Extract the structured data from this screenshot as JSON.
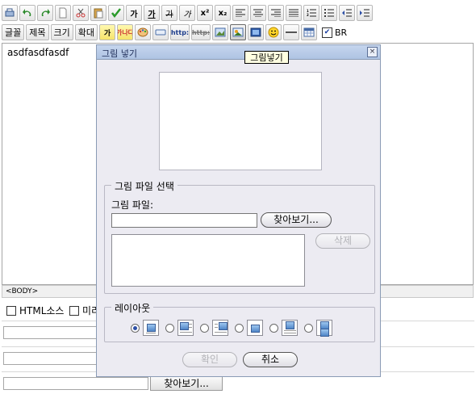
{
  "toolbar_row1": [
    {
      "name": "print-icon",
      "label": ""
    },
    {
      "name": "undo-icon",
      "label": ""
    },
    {
      "name": "redo-icon",
      "label": ""
    },
    {
      "name": "new-page-icon",
      "label": ""
    },
    {
      "name": "cut-icon",
      "label": ""
    },
    {
      "name": "paste-icon",
      "label": ""
    },
    {
      "name": "spellcheck-icon",
      "label": ""
    },
    {
      "name": "bold-button",
      "label": "가"
    },
    {
      "name": "underline-button",
      "label": "가"
    },
    {
      "name": "strikethrough-button",
      "label": "가"
    },
    {
      "name": "italic-button",
      "label": "가"
    },
    {
      "name": "superscript-button",
      "label": "x²"
    },
    {
      "name": "subscript-button",
      "label": "x₂"
    },
    {
      "name": "align-left-icon",
      "label": ""
    },
    {
      "name": "align-center-icon",
      "label": ""
    },
    {
      "name": "align-right-icon",
      "label": ""
    },
    {
      "name": "align-justify-icon",
      "label": ""
    },
    {
      "name": "numbered-list-icon",
      "label": ""
    },
    {
      "name": "bullet-list-icon",
      "label": ""
    },
    {
      "name": "outdent-icon",
      "label": ""
    },
    {
      "name": "indent-icon",
      "label": ""
    }
  ],
  "toolbar_row2": {
    "font_label": "글꼴",
    "style_label": "제목",
    "size_label": "크기",
    "zoom_label": "확대",
    "fore_color_label": "가",
    "back_color_label": "가나다",
    "http_label": "http:",
    "br_label": "BR"
  },
  "editor": {
    "content": "asdfasdfasdf",
    "status": "<BODY>"
  },
  "options": {
    "html_source": "HTML소스",
    "preview_partial": "미리"
  },
  "bottom": {
    "browse_label": "찾아보기..."
  },
  "dialog": {
    "title": "그림 넣기",
    "close_glyph": "×",
    "select_section": "그림 파일 선택",
    "file_label": "그림 파일:",
    "browse_label": "찾아보기...",
    "delete_label": "삭제",
    "layout_section": "레이아웃",
    "ok_label": "확인",
    "cancel_label": "취소"
  },
  "tooltip": "그림넣기"
}
